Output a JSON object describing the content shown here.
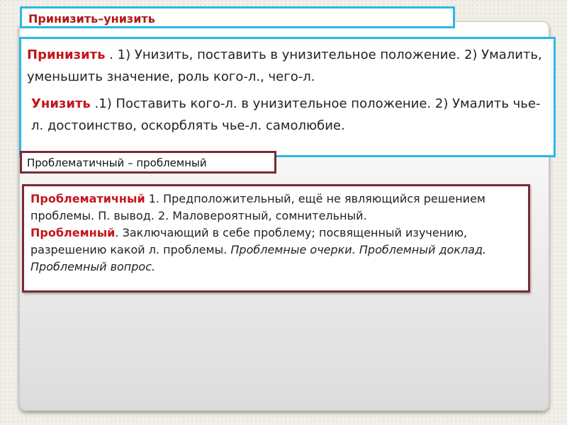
{
  "slide_title": "Принизить–унизить",
  "box1": {
    "term1": "Принизить",
    "def1": " . 1) Унизить, поставить в унизительное положение. 2) Умалить, уменьшить значение, роль кого-л., чего-л.",
    "term2": "Унизить",
    "def2": " .1) Поставить кого-л. в унизительное положение. 2) Умалить чье-л. достоинство, оскорблять чье-л. самолюбие."
  },
  "section2_title": "Проблематичный – проблемный",
  "box2": {
    "term1": "Проблематичный",
    "def1": " 1. Предположительный, ещё не являющийся решением проблемы. П. вывод. 2. Маловероятный, сомнительный.",
    "term2": "Проблемный",
    "def2": ". Заключающий в себе проблему; посвященный изучению, разрешению какой л. проблемы. ",
    "examples": "Проблемные очерки. Проблемный доклад. Проблемный вопрос."
  }
}
